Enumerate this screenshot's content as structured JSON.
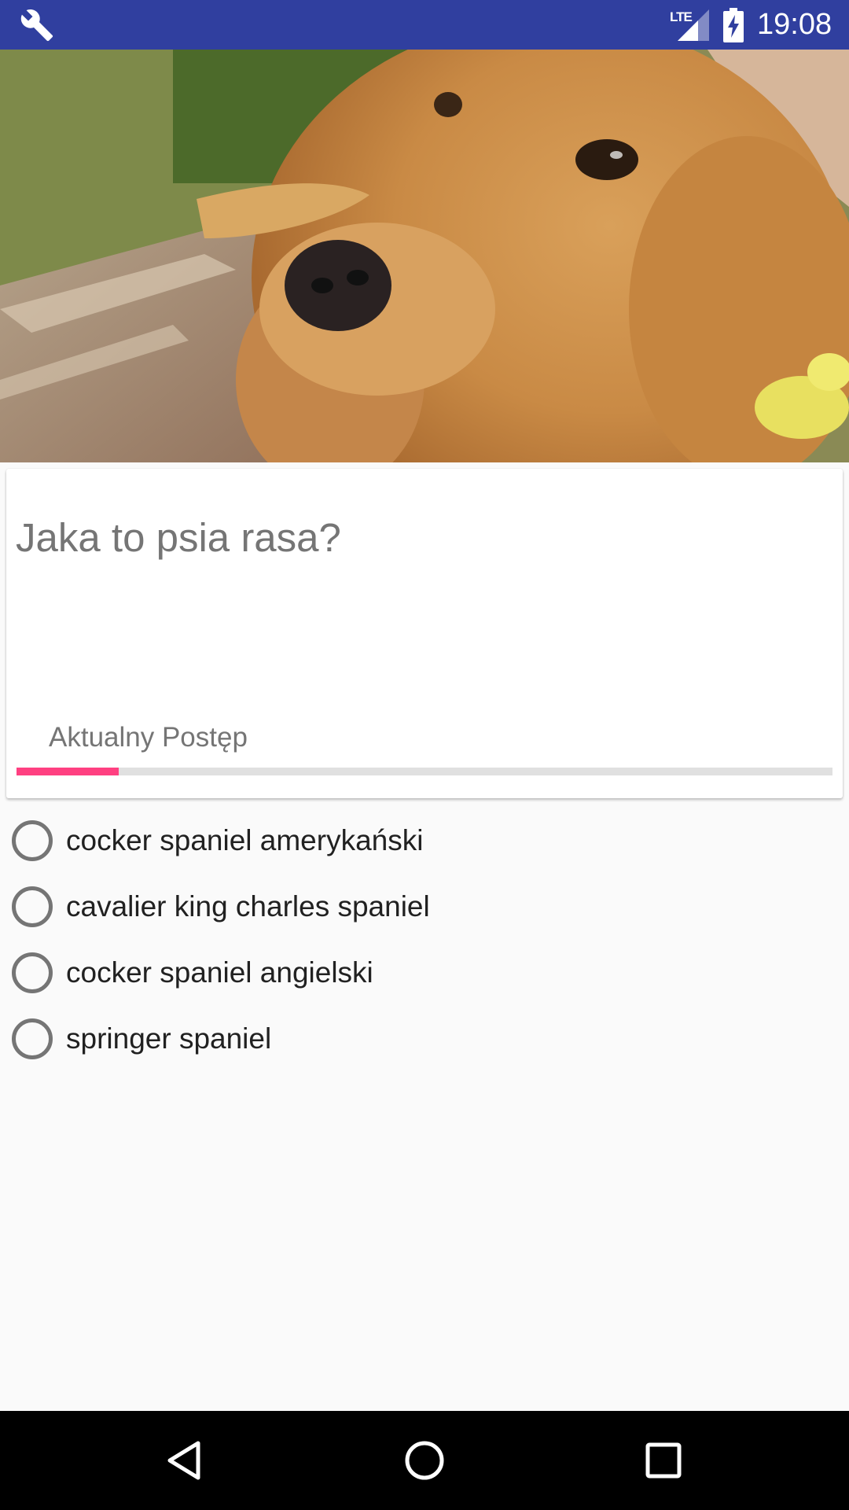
{
  "status_bar": {
    "network": "LTE",
    "time": "19:08",
    "icons": [
      "wrench-icon",
      "signal-icon",
      "battery-charging-icon"
    ],
    "color": "#303f9f"
  },
  "hero": {
    "image": "dog-photo"
  },
  "card": {
    "question": "Jaka to psia rasa?",
    "progress_label": "Aktualny Postęp",
    "progress": 0.125,
    "progress_color": "#ff4081"
  },
  "options": [
    {
      "label": "cocker spaniel amerykański",
      "selected": false
    },
    {
      "label": "cavalier king charles spaniel",
      "selected": false
    },
    {
      "label": "cocker spaniel angielski",
      "selected": false
    },
    {
      "label": "springer spaniel",
      "selected": false
    }
  ],
  "nav_bar": {
    "icons": [
      "back-icon",
      "home-icon",
      "recents-icon"
    ]
  }
}
